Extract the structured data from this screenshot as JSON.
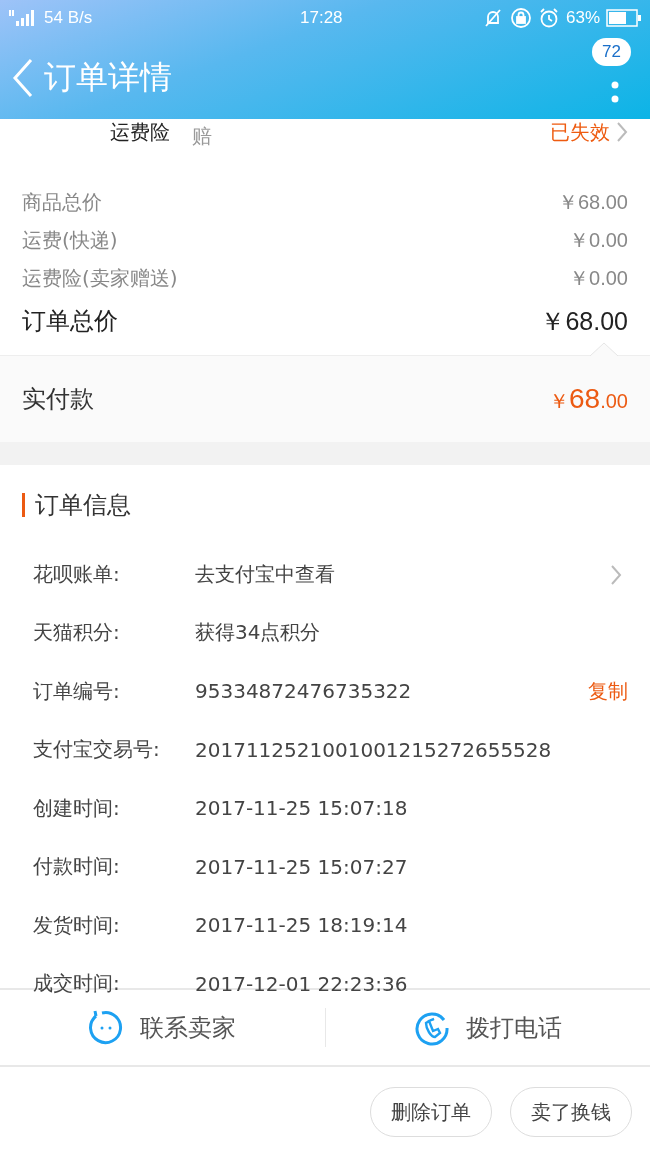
{
  "status_bar": {
    "network": "54 B/s",
    "time": "17:28",
    "battery": "63%"
  },
  "header": {
    "title": "订单详情",
    "badge": "72"
  },
  "insurance_row": {
    "label": "运费险",
    "note": "赔",
    "status": "已失效"
  },
  "price_rows": [
    {
      "label": "商品总价",
      "value": "￥68.00"
    },
    {
      "label": "运费(快递)",
      "value": "￥0.00"
    },
    {
      "label": "运费险(卖家赠送)",
      "value": "￥0.00"
    }
  ],
  "total": {
    "label": "订单总价",
    "value": "￥68.00"
  },
  "paid": {
    "label": "实付款",
    "symbol": "￥",
    "main": "68",
    "fraction": ".00"
  },
  "order_info": {
    "title": "订单信息",
    "rows": [
      {
        "label": "花呗账单:",
        "value": "去支付宝中查看",
        "kind": "link"
      },
      {
        "label": "天猫积分:",
        "value": "获得34点积分",
        "kind": "plain"
      },
      {
        "label": "订单编号:",
        "value": "95334872476735322",
        "kind": "copy",
        "action": "复制"
      },
      {
        "label": "支付宝交易号:",
        "value": "2017112521001001215272655528",
        "kind": "plain"
      },
      {
        "label": "创建时间:",
        "value": "2017-11-25 15:07:18",
        "kind": "plain"
      },
      {
        "label": "付款时间:",
        "value": "2017-11-25 15:07:27",
        "kind": "plain"
      },
      {
        "label": "发货时间:",
        "value": "2017-11-25 18:19:14",
        "kind": "plain"
      },
      {
        "label": "成交时间:",
        "value": "2017-12-01 22:23:36",
        "kind": "plain"
      }
    ]
  },
  "contact_bar": [
    {
      "label": "联系卖家",
      "kind": "chat"
    },
    {
      "label": "拨打电话",
      "kind": "phone"
    }
  ],
  "buttons": [
    "删除订单",
    "卖了换钱"
  ]
}
